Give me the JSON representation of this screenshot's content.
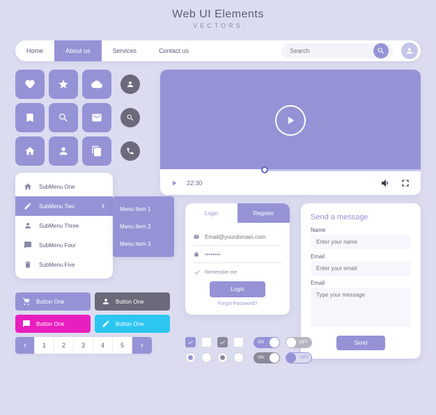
{
  "title": "Web UI Elements",
  "subtitle": "VECTORS",
  "nav": {
    "items": [
      "Home",
      "About us",
      "Services",
      "Contact us"
    ],
    "active_index": 1,
    "search_placeholder": "Search"
  },
  "icon_grid": {
    "square_icons": [
      "heart",
      "star",
      "cloud",
      "bookmark",
      "search",
      "mail",
      "home",
      "user",
      "copy"
    ],
    "round_icons": [
      "user",
      "search",
      "phone"
    ]
  },
  "video": {
    "time": "22:30",
    "progress_pct": 40
  },
  "submenu": {
    "items": [
      "SubMenu One",
      "SubMenu Two",
      "SubMenu Three",
      "SubMenu Four",
      "SubMenu Five"
    ],
    "active_index": 1,
    "icons": [
      "home",
      "pencil",
      "user",
      "chat",
      "trash"
    ]
  },
  "flyout": {
    "items": [
      "Menu Item 1",
      "Menu Item 2",
      "Menu Item 3"
    ]
  },
  "buttons": [
    {
      "label": "Button One",
      "color": "purple",
      "icon": "cart"
    },
    {
      "label": "Button One",
      "color": "gray",
      "icon": "user"
    },
    {
      "label": "Button One",
      "color": "pink",
      "icon": "chat"
    },
    {
      "label": "Button One",
      "color": "cyan",
      "icon": "pencil"
    }
  ],
  "pager": {
    "pages": [
      "1",
      "2",
      "3",
      "4",
      "5"
    ]
  },
  "login": {
    "tab_login": "Login",
    "tab_register": "Register",
    "email_placeholder": "Email@yourdomain.com",
    "password_value": "••••••••",
    "remember": "Remember me",
    "submit": "Login",
    "forgot": "Forgot Password?"
  },
  "contact": {
    "heading": "Send a message",
    "name_label": "Name",
    "name_placeholder": "Enter your name",
    "email_label": "Email",
    "email_placeholder": "Enter your email",
    "msg_label": "Email",
    "msg_placeholder": "Type your message",
    "send": "Send"
  },
  "toggles": {
    "on": "ON",
    "off": "OFF"
  }
}
